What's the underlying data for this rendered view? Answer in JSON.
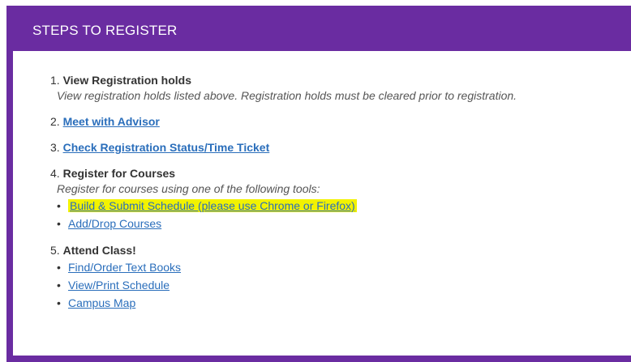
{
  "panel": {
    "title": "STEPS TO REGISTER",
    "accent_color": "#6a2ca1",
    "highlight_color": "#f2f200"
  },
  "steps": [
    {
      "number": "1.",
      "title": "View Registration holds",
      "description": "View registration holds listed above. Registration holds must be cleared prior to registration."
    },
    {
      "number": "2.",
      "link": "Meet with Advisor"
    },
    {
      "number": "3.",
      "link": "Check Registration Status/Time Ticket"
    },
    {
      "number": "4.",
      "title": "Register for Courses",
      "description": "Register for courses using one of the following tools:",
      "links": [
        "Build & Submit Schedule (please use Chrome or Firefox)",
        "Add/Drop Courses"
      ]
    },
    {
      "number": "5.",
      "title": "Attend Class!",
      "links": [
        "Find/Order Text Books",
        "View/Print Schedule",
        "Campus Map"
      ]
    }
  ],
  "bullet_icon": "•"
}
